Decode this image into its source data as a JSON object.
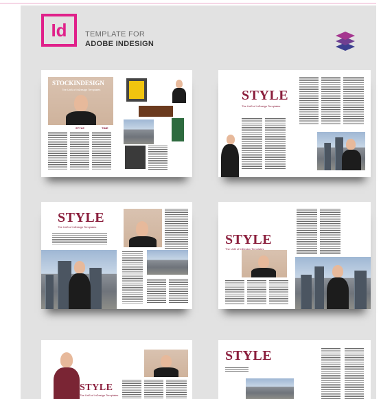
{
  "header": {
    "logo_text": "Id",
    "line1": "TEMPLATE FOR",
    "line2": "ADOBE INDESIGN",
    "icon": "layers-icon"
  },
  "colors": {
    "accent": "#e0218a",
    "title": "#8b1f3d",
    "layers_top": "#a5368f",
    "layers_mid": "#6f3f91",
    "layers_bottom": "#3b3f8f"
  },
  "spreads": {
    "s1": {
      "masthead": "STOCKINDESIGN",
      "tagline": "The UnB of InDesign Templates",
      "label_a": "STYLE",
      "label_b": "TIME"
    },
    "s2": {
      "title": "STYLE",
      "subtitle": "The UnB of InDesign Templates"
    },
    "s3": {
      "title": "STYLE",
      "subtitle": "The UnB of InDesign Templates"
    },
    "s4": {
      "title": "STYLE",
      "subtitle": "The UnB of InDesign Templates"
    },
    "s5": {
      "title": "STYLE",
      "subtitle": "The UnB of InDesign Templates"
    },
    "s6": {
      "title": "STYLE"
    }
  }
}
